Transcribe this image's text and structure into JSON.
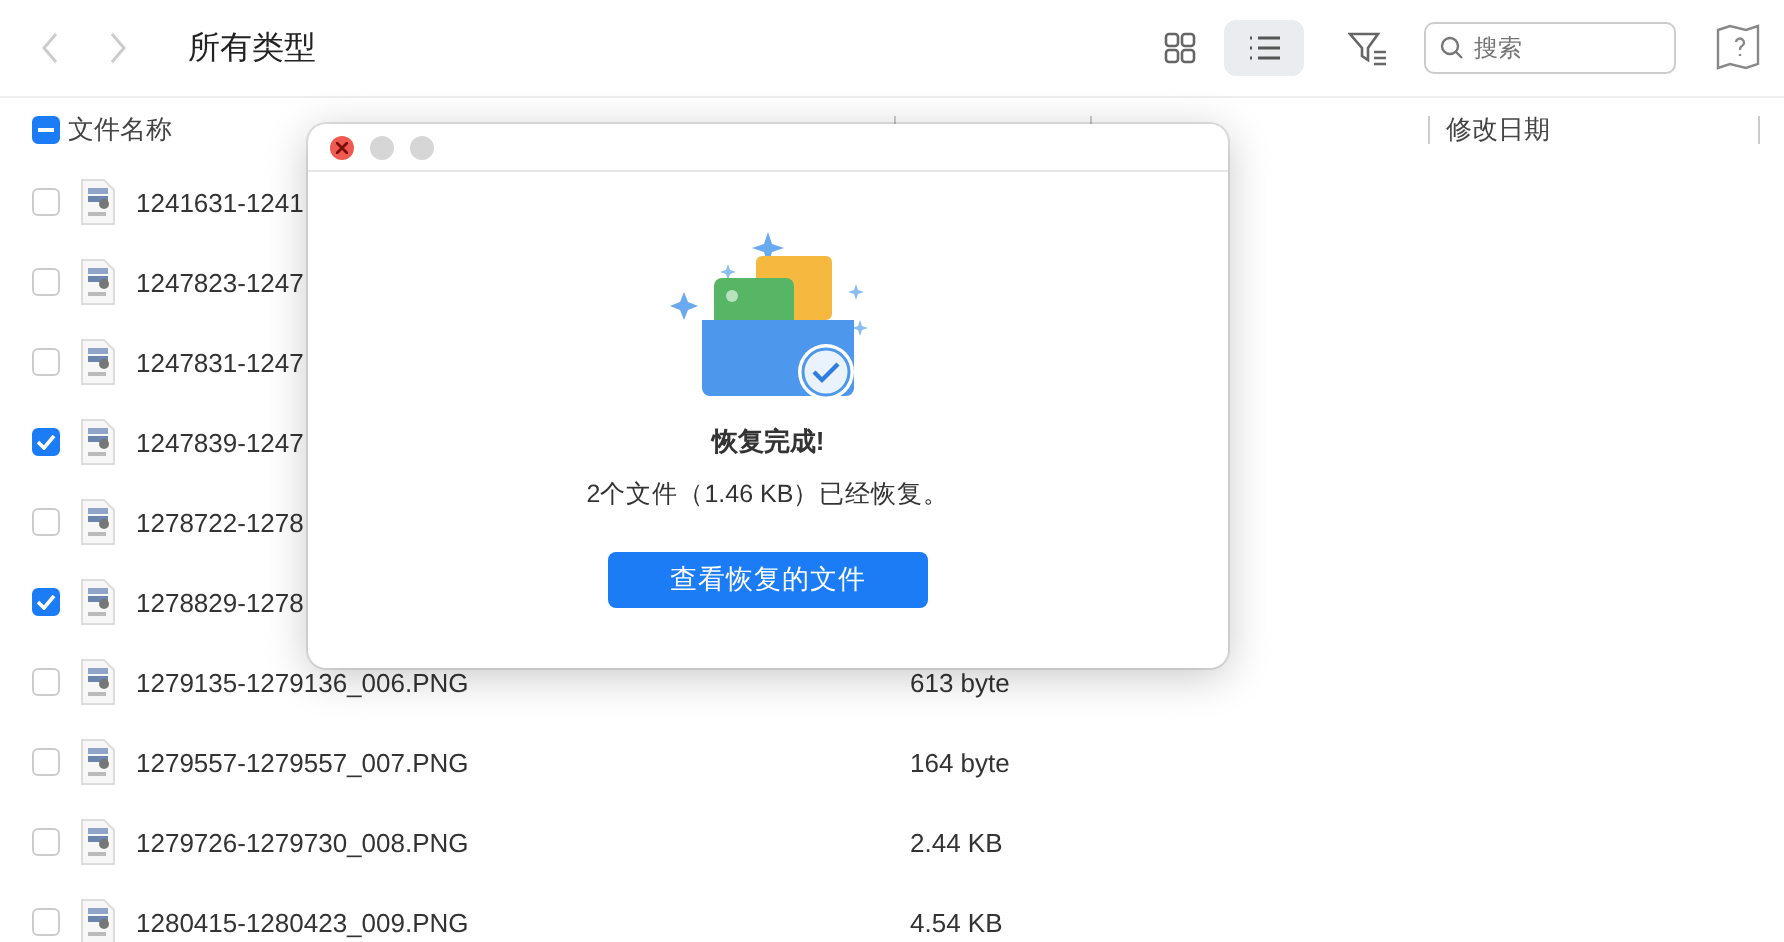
{
  "toolbar": {
    "title": "所有类型",
    "search": {
      "placeholder": "搜索"
    },
    "view_modes": [
      {
        "kind": "grid",
        "selected": false
      },
      {
        "kind": "list",
        "selected": true
      }
    ]
  },
  "table": {
    "header_indeterminate": true,
    "columns": [
      "文件名称",
      "修改日期"
    ],
    "rows": [
      {
        "name": "1241631-1241",
        "checked": false
      },
      {
        "name": "1247823-1247",
        "checked": false
      },
      {
        "name": "1247831-1247",
        "checked": false
      },
      {
        "name": "1247839-1247",
        "checked": true
      },
      {
        "name": "1278722-1278",
        "checked": false
      },
      {
        "name": "1278829-1278",
        "checked": true
      },
      {
        "name": "1279135-1279136_006.PNG",
        "size": "613 byte",
        "checked": false
      },
      {
        "name": "1279557-1279557_007.PNG",
        "size": "164 byte",
        "checked": false
      },
      {
        "name": "1279726-1279730_008.PNG",
        "size": "2.44 KB",
        "checked": false
      },
      {
        "name": "1280415-1280423_009.PNG",
        "size": "4.54 KB",
        "checked": false
      }
    ]
  },
  "dialog": {
    "title": "恢复完成!",
    "message": "2个文件（1.46 KB）已经恢复。",
    "button": "查看恢复的文件"
  }
}
